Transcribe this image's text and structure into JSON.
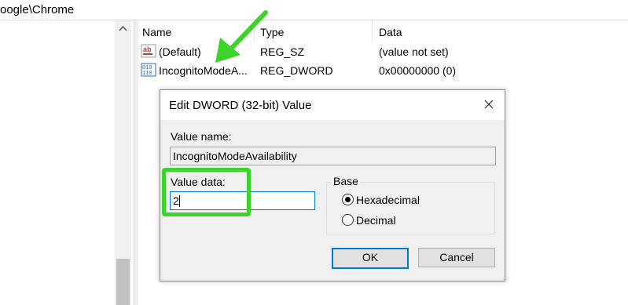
{
  "address": {
    "path": "oogle\\Chrome"
  },
  "list": {
    "columns": [
      "Name",
      "Type",
      "Data"
    ],
    "rows": [
      {
        "icon": "string-value-icon",
        "name": "(Default)",
        "type": "REG_SZ",
        "data": "(value not set)"
      },
      {
        "icon": "binary-value-icon",
        "name": "IncognitoModeA...",
        "type": "REG_DWORD",
        "data": "0x00000000 (0)"
      }
    ]
  },
  "dialog": {
    "title": "Edit DWORD (32-bit) Value",
    "value_name_label": "Value name:",
    "value_name": "IncognitoModeAvailability",
    "value_data_label": "Value data:",
    "value_data": "2",
    "base_label": "Base",
    "radio_hex": "Hexadecimal",
    "radio_dec": "Decimal",
    "selected_base": "Hexadecimal",
    "ok_label": "OK",
    "cancel_label": "Cancel"
  },
  "colors": {
    "annotation": "#3cd32a",
    "accent": "#0078d7"
  }
}
